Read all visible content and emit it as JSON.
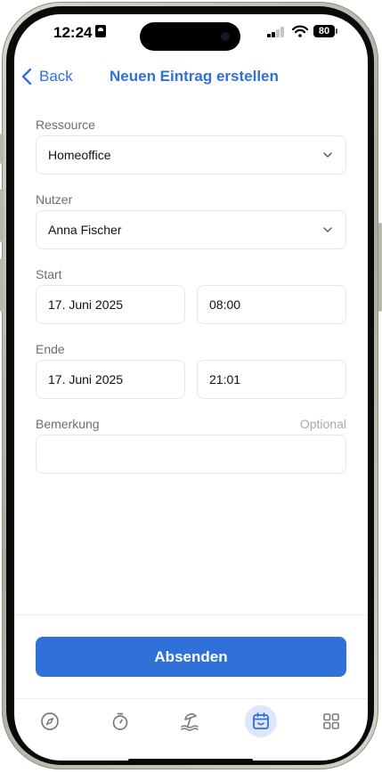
{
  "status": {
    "time": "12:24",
    "battery": "80"
  },
  "nav": {
    "back_label": "Back",
    "title": "Neuen Eintrag erstellen"
  },
  "form": {
    "resource": {
      "label": "Ressource",
      "value": "Homeoffice"
    },
    "user": {
      "label": "Nutzer",
      "value": "Anna Fischer"
    },
    "start": {
      "label": "Start",
      "date": "17. Juni 2025",
      "time": "08:00"
    },
    "end": {
      "label": "Ende",
      "date": "17. Juni 2025",
      "time": "21:01"
    },
    "remark": {
      "label": "Bemerkung",
      "optional": "Optional",
      "value": ""
    }
  },
  "submit_label": "Absenden",
  "tabs": [
    {
      "icon": "compass-icon",
      "active": false
    },
    {
      "icon": "stopwatch-icon",
      "active": false
    },
    {
      "icon": "beach-icon",
      "active": false
    },
    {
      "icon": "calendar-icon",
      "active": true
    },
    {
      "icon": "grid-icon",
      "active": false
    }
  ],
  "colors": {
    "accent": "#2f70d9",
    "active_tab_bg": "#dce7fb"
  }
}
